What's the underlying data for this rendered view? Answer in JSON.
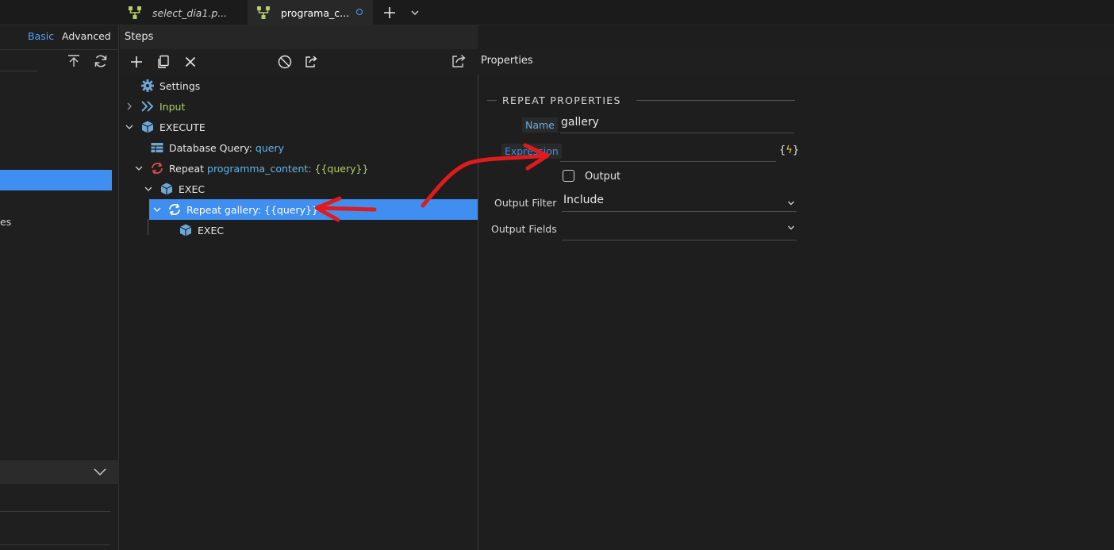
{
  "tabs": [
    {
      "label": "select_dia1.p...",
      "icon": "flow-icon",
      "active": false
    },
    {
      "label": "programa_c...",
      "icon": "flow-icon",
      "active": true,
      "modified": true
    }
  ],
  "left_panel": {
    "mode_basic": "Basic",
    "mode_advanced": "Advanced",
    "partial_text": "es"
  },
  "steps": {
    "title": "Steps",
    "tree": [
      {
        "label": "Settings"
      },
      {
        "label": "Input"
      },
      {
        "label": "EXECUTE"
      },
      {
        "label": "Database Query:",
        "value": "query"
      },
      {
        "label": "Repeat",
        "name": "programma_content:",
        "value": "{{query}}"
      },
      {
        "label": "EXEC"
      },
      {
        "label": "Repeat gallery: {{query}}",
        "selected": true
      },
      {
        "label": "EXEC"
      }
    ]
  },
  "properties": {
    "title": "Properties",
    "section": "REPEAT PROPERTIES",
    "name_label": "Name",
    "name_value": "gallery",
    "expression_label": "Expression",
    "expression_value": "",
    "expression_button_open": "{",
    "expression_button_bolt": "ϟ",
    "expression_button_close": "}",
    "output_label": "Output",
    "output_checked": false,
    "output_filter_label": "Output Filter",
    "output_filter_value": "Include",
    "output_fields_label": "Output Fields",
    "output_fields_value": ""
  },
  "colors": {
    "accent": "#3f8ef0",
    "annotation": "#e01b1b",
    "green_label": "#b5cc6a",
    "blue_label": "#5fb3e8"
  }
}
